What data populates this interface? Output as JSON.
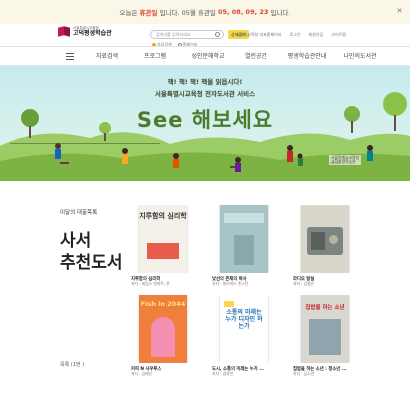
{
  "notice": {
    "prefix": "오늘은",
    "today_status": "휴관일",
    "middle": "입니다. 05월 휴관일",
    "dates": "05, 08, 09, 23",
    "suffix": "입니다."
  },
  "header": {
    "logo_sub": "서울특별시교육청",
    "logo_main": "고덕평생학습관",
    "search_placeholder": "검색어를 입력하세요",
    "search_button": "상세검색",
    "scope": [
      "자료검색",
      "홈페이지"
    ],
    "util_links": [
      "서울시교육청 대표홈페이지",
      "로그인",
      "회원가입",
      "사이트맵"
    ]
  },
  "nav": {
    "items": [
      "자료검색",
      "프로그램",
      "성인문해학교",
      "열린공간",
      "평생학습관안내",
      "나만의도서관"
    ]
  },
  "banner": {
    "line1": "책! 책! 책! 책을 읽읍시다!",
    "line2": "서울특별시교육청 전자도서관 서비스",
    "title": "See 해보세요",
    "logo_sub": "서울특별시교육청",
    "logo_main": "고덕평생학습관"
  },
  "recommend": {
    "small_label": "이달의 대출목록",
    "title_line1": "사서",
    "title_line2": "추천도서",
    "more": "목록 (1번 )",
    "books": [
      {
        "title": "지루함의 심리학",
        "author": "저자 : 제임스 댄커트, 존",
        "cover_color": "#f4f1ea",
        "cover_text": "지루함의 심리학"
      },
      {
        "title": "낯선의 존재의 박사",
        "author": "저자 : 데이비드 존스턴",
        "cover_color": "#a7c4c6",
        "cover_text": ""
      },
      {
        "title": "라디오 탐설",
        "author": "저자 : 김형은",
        "cover_color": "#7d8580",
        "cover_text": ""
      },
      {
        "title": "커피 N 사우루스",
        "author": "저자 : 김혜인",
        "cover_color": "#f07f3c",
        "cover_text": "Fish in 2044"
      },
      {
        "title": "도시, 소통의 미래는 누가 ...",
        "author": "저자 : 광자연",
        "cover_color": "#3fa8d8",
        "cover_text": "소통의 미래는 누가 디자인 하는가"
      },
      {
        "title": "집밥을 하는 소년 : 청소년 ...",
        "author": "저자 : 김소연",
        "cover_color": "#d8d8d0",
        "cover_text": "집밥을 하는 소년"
      }
    ]
  }
}
